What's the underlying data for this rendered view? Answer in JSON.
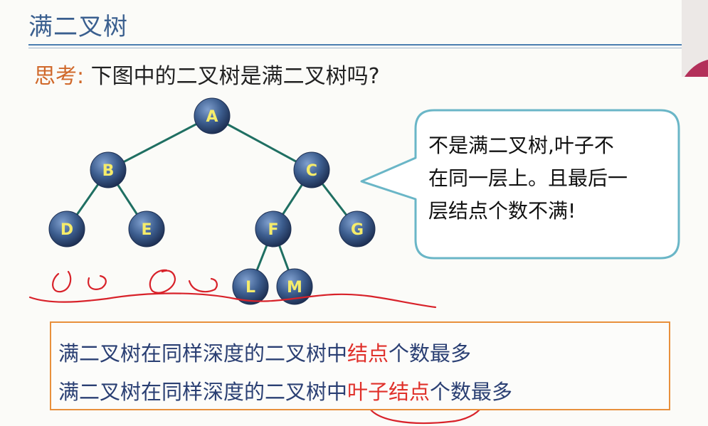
{
  "slide": {
    "title": "满二叉树"
  },
  "question": {
    "label": "思考:",
    "text": "下图中的二叉树是满二叉树吗?"
  },
  "tree": {
    "nodes": [
      "A",
      "B",
      "C",
      "D",
      "E",
      "F",
      "G",
      "L",
      "M"
    ],
    "edges": [
      [
        "A",
        "B"
      ],
      [
        "A",
        "C"
      ],
      [
        "B",
        "D"
      ],
      [
        "B",
        "E"
      ],
      [
        "C",
        "F"
      ],
      [
        "C",
        "G"
      ],
      [
        "F",
        "L"
      ],
      [
        "F",
        "M"
      ]
    ],
    "node_color": "#3c5d8e",
    "label_color": "#f6ec6a",
    "edge_color": "#1f6f62"
  },
  "answer_bubble": {
    "lines": [
      "不是满二叉树,叶子不",
      "在同一层上。且最后一",
      "层结点个数不满!"
    ],
    "border_color": "#6ab6c7"
  },
  "summary": {
    "line1": {
      "before": "满二叉树在同样深度的二叉树中",
      "highlight": "结点",
      "after": "个数最多"
    },
    "line2": {
      "before": "满二叉树在同样深度的二叉树中",
      "highlight": "叶子结点",
      "after": "个数最多"
    },
    "border_color": "#e8903c",
    "highlight_color": "#e0302a"
  },
  "annotation_color": "#d8222a"
}
